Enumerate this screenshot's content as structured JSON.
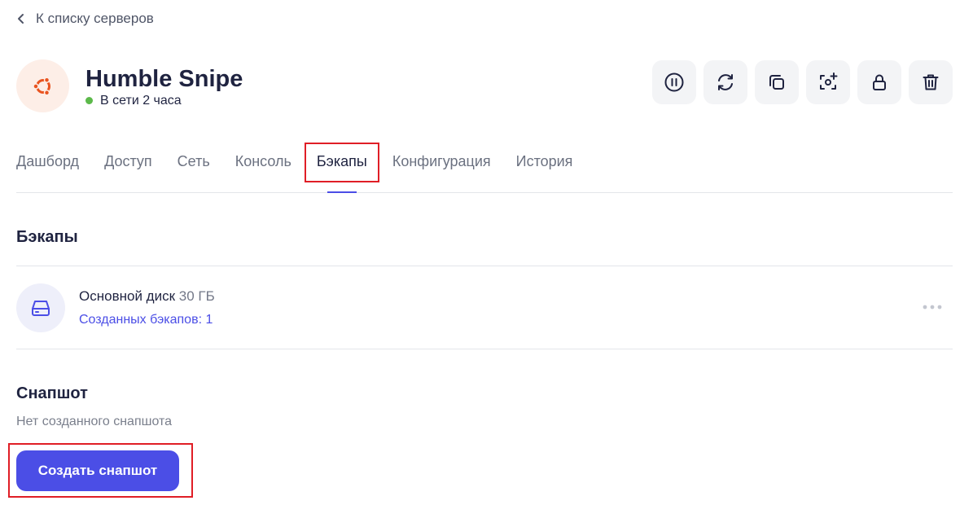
{
  "nav": {
    "back_label": "К списку серверов",
    "back_icon": "chevron-left-icon"
  },
  "server": {
    "name": "Humble Snipe",
    "status": "В сети 2 часа",
    "status_color": "#5cb94a",
    "os_icon": "ubuntu-logo-icon",
    "os_color": "#e95420"
  },
  "actions": [
    {
      "icon": "pause-icon"
    },
    {
      "icon": "reboot-icon"
    },
    {
      "icon": "clone-icon"
    },
    {
      "icon": "snapshot-camera-icon"
    },
    {
      "icon": "lock-icon"
    },
    {
      "icon": "trash-icon"
    }
  ],
  "tabs": [
    {
      "label": "Дашборд",
      "active": false
    },
    {
      "label": "Доступ",
      "active": false
    },
    {
      "label": "Сеть",
      "active": false
    },
    {
      "label": "Консоль",
      "active": false
    },
    {
      "label": "Бэкапы",
      "active": true
    },
    {
      "label": "Конфигурация",
      "active": false
    },
    {
      "label": "История",
      "active": false
    }
  ],
  "backups": {
    "title": "Бэкапы",
    "disk": {
      "name": "Основной диск",
      "size": "30 ГБ",
      "backups_link": "Созданных бэкапов: 1",
      "icon": "hard-drive-icon"
    }
  },
  "snapshot": {
    "title": "Снапшот",
    "empty_text": "Нет созданного снапшота",
    "create_label": "Создать снапшот"
  },
  "colors": {
    "accent": "#4b4ee6",
    "highlight": "#e01e26",
    "text": "#1f2340"
  }
}
